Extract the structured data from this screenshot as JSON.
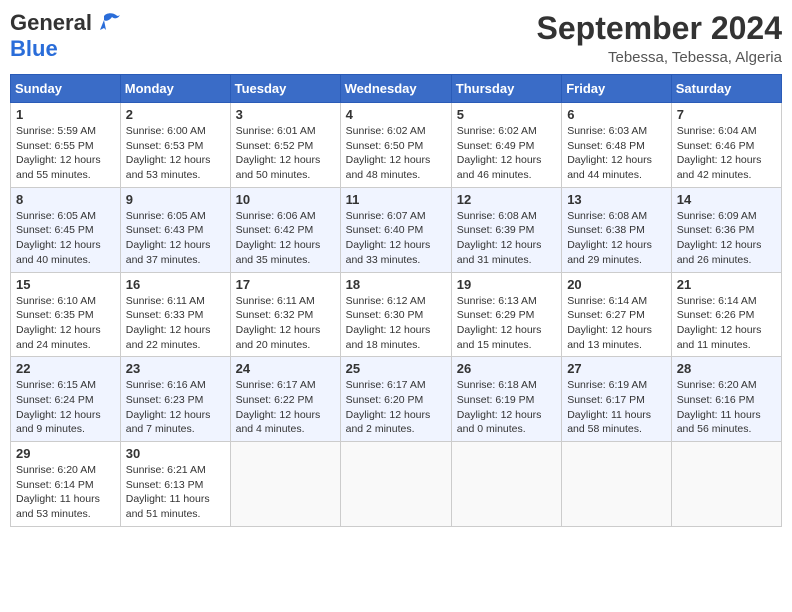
{
  "header": {
    "logo_general": "General",
    "logo_blue": "Blue",
    "month_title": "September 2024",
    "location": "Tebessa, Tebessa, Algeria"
  },
  "weekdays": [
    "Sunday",
    "Monday",
    "Tuesday",
    "Wednesday",
    "Thursday",
    "Friday",
    "Saturday"
  ],
  "weeks": [
    [
      {
        "day": "1",
        "sunrise": "5:59 AM",
        "sunset": "6:55 PM",
        "daylight": "12 hours and 55 minutes."
      },
      {
        "day": "2",
        "sunrise": "6:00 AM",
        "sunset": "6:53 PM",
        "daylight": "12 hours and 53 minutes."
      },
      {
        "day": "3",
        "sunrise": "6:01 AM",
        "sunset": "6:52 PM",
        "daylight": "12 hours and 50 minutes."
      },
      {
        "day": "4",
        "sunrise": "6:02 AM",
        "sunset": "6:50 PM",
        "daylight": "12 hours and 48 minutes."
      },
      {
        "day": "5",
        "sunrise": "6:02 AM",
        "sunset": "6:49 PM",
        "daylight": "12 hours and 46 minutes."
      },
      {
        "day": "6",
        "sunrise": "6:03 AM",
        "sunset": "6:48 PM",
        "daylight": "12 hours and 44 minutes."
      },
      {
        "day": "7",
        "sunrise": "6:04 AM",
        "sunset": "6:46 PM",
        "daylight": "12 hours and 42 minutes."
      }
    ],
    [
      {
        "day": "8",
        "sunrise": "6:05 AM",
        "sunset": "6:45 PM",
        "daylight": "12 hours and 40 minutes."
      },
      {
        "day": "9",
        "sunrise": "6:05 AM",
        "sunset": "6:43 PM",
        "daylight": "12 hours and 37 minutes."
      },
      {
        "day": "10",
        "sunrise": "6:06 AM",
        "sunset": "6:42 PM",
        "daylight": "12 hours and 35 minutes."
      },
      {
        "day": "11",
        "sunrise": "6:07 AM",
        "sunset": "6:40 PM",
        "daylight": "12 hours and 33 minutes."
      },
      {
        "day": "12",
        "sunrise": "6:08 AM",
        "sunset": "6:39 PM",
        "daylight": "12 hours and 31 minutes."
      },
      {
        "day": "13",
        "sunrise": "6:08 AM",
        "sunset": "6:38 PM",
        "daylight": "12 hours and 29 minutes."
      },
      {
        "day": "14",
        "sunrise": "6:09 AM",
        "sunset": "6:36 PM",
        "daylight": "12 hours and 26 minutes."
      }
    ],
    [
      {
        "day": "15",
        "sunrise": "6:10 AM",
        "sunset": "6:35 PM",
        "daylight": "12 hours and 24 minutes."
      },
      {
        "day": "16",
        "sunrise": "6:11 AM",
        "sunset": "6:33 PM",
        "daylight": "12 hours and 22 minutes."
      },
      {
        "day": "17",
        "sunrise": "6:11 AM",
        "sunset": "6:32 PM",
        "daylight": "12 hours and 20 minutes."
      },
      {
        "day": "18",
        "sunrise": "6:12 AM",
        "sunset": "6:30 PM",
        "daylight": "12 hours and 18 minutes."
      },
      {
        "day": "19",
        "sunrise": "6:13 AM",
        "sunset": "6:29 PM",
        "daylight": "12 hours and 15 minutes."
      },
      {
        "day": "20",
        "sunrise": "6:14 AM",
        "sunset": "6:27 PM",
        "daylight": "12 hours and 13 minutes."
      },
      {
        "day": "21",
        "sunrise": "6:14 AM",
        "sunset": "6:26 PM",
        "daylight": "12 hours and 11 minutes."
      }
    ],
    [
      {
        "day": "22",
        "sunrise": "6:15 AM",
        "sunset": "6:24 PM",
        "daylight": "12 hours and 9 minutes."
      },
      {
        "day": "23",
        "sunrise": "6:16 AM",
        "sunset": "6:23 PM",
        "daylight": "12 hours and 7 minutes."
      },
      {
        "day": "24",
        "sunrise": "6:17 AM",
        "sunset": "6:22 PM",
        "daylight": "12 hours and 4 minutes."
      },
      {
        "day": "25",
        "sunrise": "6:17 AM",
        "sunset": "6:20 PM",
        "daylight": "12 hours and 2 minutes."
      },
      {
        "day": "26",
        "sunrise": "6:18 AM",
        "sunset": "6:19 PM",
        "daylight": "12 hours and 0 minutes."
      },
      {
        "day": "27",
        "sunrise": "6:19 AM",
        "sunset": "6:17 PM",
        "daylight": "11 hours and 58 minutes."
      },
      {
        "day": "28",
        "sunrise": "6:20 AM",
        "sunset": "6:16 PM",
        "daylight": "11 hours and 56 minutes."
      }
    ],
    [
      {
        "day": "29",
        "sunrise": "6:20 AM",
        "sunset": "6:14 PM",
        "daylight": "11 hours and 53 minutes."
      },
      {
        "day": "30",
        "sunrise": "6:21 AM",
        "sunset": "6:13 PM",
        "daylight": "11 hours and 51 minutes."
      },
      null,
      null,
      null,
      null,
      null
    ]
  ]
}
